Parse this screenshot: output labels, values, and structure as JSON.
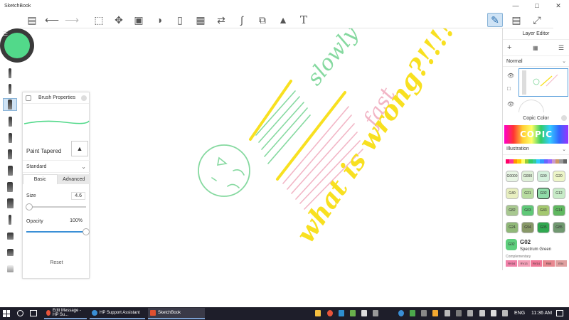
{
  "app": {
    "title": "SketchBook"
  },
  "toolbar": {
    "buttons": [
      {
        "name": "lagoon-icon"
      },
      {
        "name": "undo-icon"
      },
      {
        "name": "redo-icon"
      },
      {
        "name": "select-icon"
      },
      {
        "name": "transform-icon"
      },
      {
        "name": "crop-icon"
      },
      {
        "name": "fill-icon"
      },
      {
        "name": "ruler-icon"
      },
      {
        "name": "perspective-icon"
      },
      {
        "name": "symmetry-icon"
      },
      {
        "name": "curve-icon"
      },
      {
        "name": "shapes-icon"
      },
      {
        "name": "image-icon"
      },
      {
        "name": "text-icon"
      },
      {
        "name": "brush-tool-icon"
      },
      {
        "name": "window-icon"
      },
      {
        "name": "fullscreen-icon"
      }
    ],
    "text_glyph": "T"
  },
  "color_puck": {
    "color": "#52d98a"
  },
  "brush_properties": {
    "title": "Brush Properties",
    "brush_name": "Paint Tapered",
    "preset": "Standard",
    "tabs": {
      "basic": "Basic",
      "advanced": "Advanced"
    },
    "size_label": "Size",
    "size_value": "4.6",
    "size_level": 0.05,
    "opacity_label": "Opacity",
    "opacity_value": "100%",
    "opacity_level": 1.0,
    "reset_label": "Reset"
  },
  "layer_editor": {
    "title": "Layer Editor",
    "blend_mode": "Normal"
  },
  "copic": {
    "title": "Copic Color",
    "logo": "COPIC",
    "category": "Illustration",
    "swatches": [
      {
        "code": "G0000",
        "color": "#e8f5e4"
      },
      {
        "code": "G000",
        "color": "#dff0d8"
      },
      {
        "code": "G00",
        "color": "#d4f0dc"
      },
      {
        "code": "G20",
        "color": "#eef6c8"
      },
      {
        "code": "G40",
        "color": "#e8efc0"
      },
      {
        "code": "G21",
        "color": "#b8dca0"
      },
      {
        "code": "G02",
        "color": "#8fdca8"
      },
      {
        "code": "G12",
        "color": "#c8ecc8"
      },
      {
        "code": "G82",
        "color": "#a8c890"
      },
      {
        "code": "G03",
        "color": "#60c878"
      },
      {
        "code": "G43",
        "color": "#a4c870"
      },
      {
        "code": "G14",
        "color": "#60b860"
      },
      {
        "code": "G24",
        "color": "#90b878"
      },
      {
        "code": "G94",
        "color": "#889868"
      },
      {
        "code": "G05",
        "color": "#30a850"
      },
      {
        "code": "G85",
        "color": "#709870"
      }
    ],
    "selected_code": "G02",
    "selected_name": "Spectrum Green",
    "complementary_label": "Complementary",
    "complementary": [
      {
        "code": "RV04",
        "color": "#f080a8"
      },
      {
        "code": "RV13",
        "color": "#f4a0b8"
      },
      {
        "code": "RV14",
        "color": "#f07898"
      },
      {
        "code": "R85",
        "color": "#e88890"
      },
      {
        "code": "E04",
        "color": "#e0a0a0"
      }
    ]
  },
  "canvas": {
    "texts": {
      "slowly": "slowly",
      "fast": "fast",
      "wrong": "what is wrong?!!!!"
    }
  },
  "taskbar": {
    "tasks": [
      {
        "label": "Edit Message - HP Su...",
        "color": "#e8543a"
      },
      {
        "label": "HP Support Assistant",
        "color": "#3a8fd6"
      },
      {
        "label": "SketchBook",
        "color": "#e05030"
      }
    ],
    "language": "ENG",
    "time": "11:36 AM"
  }
}
